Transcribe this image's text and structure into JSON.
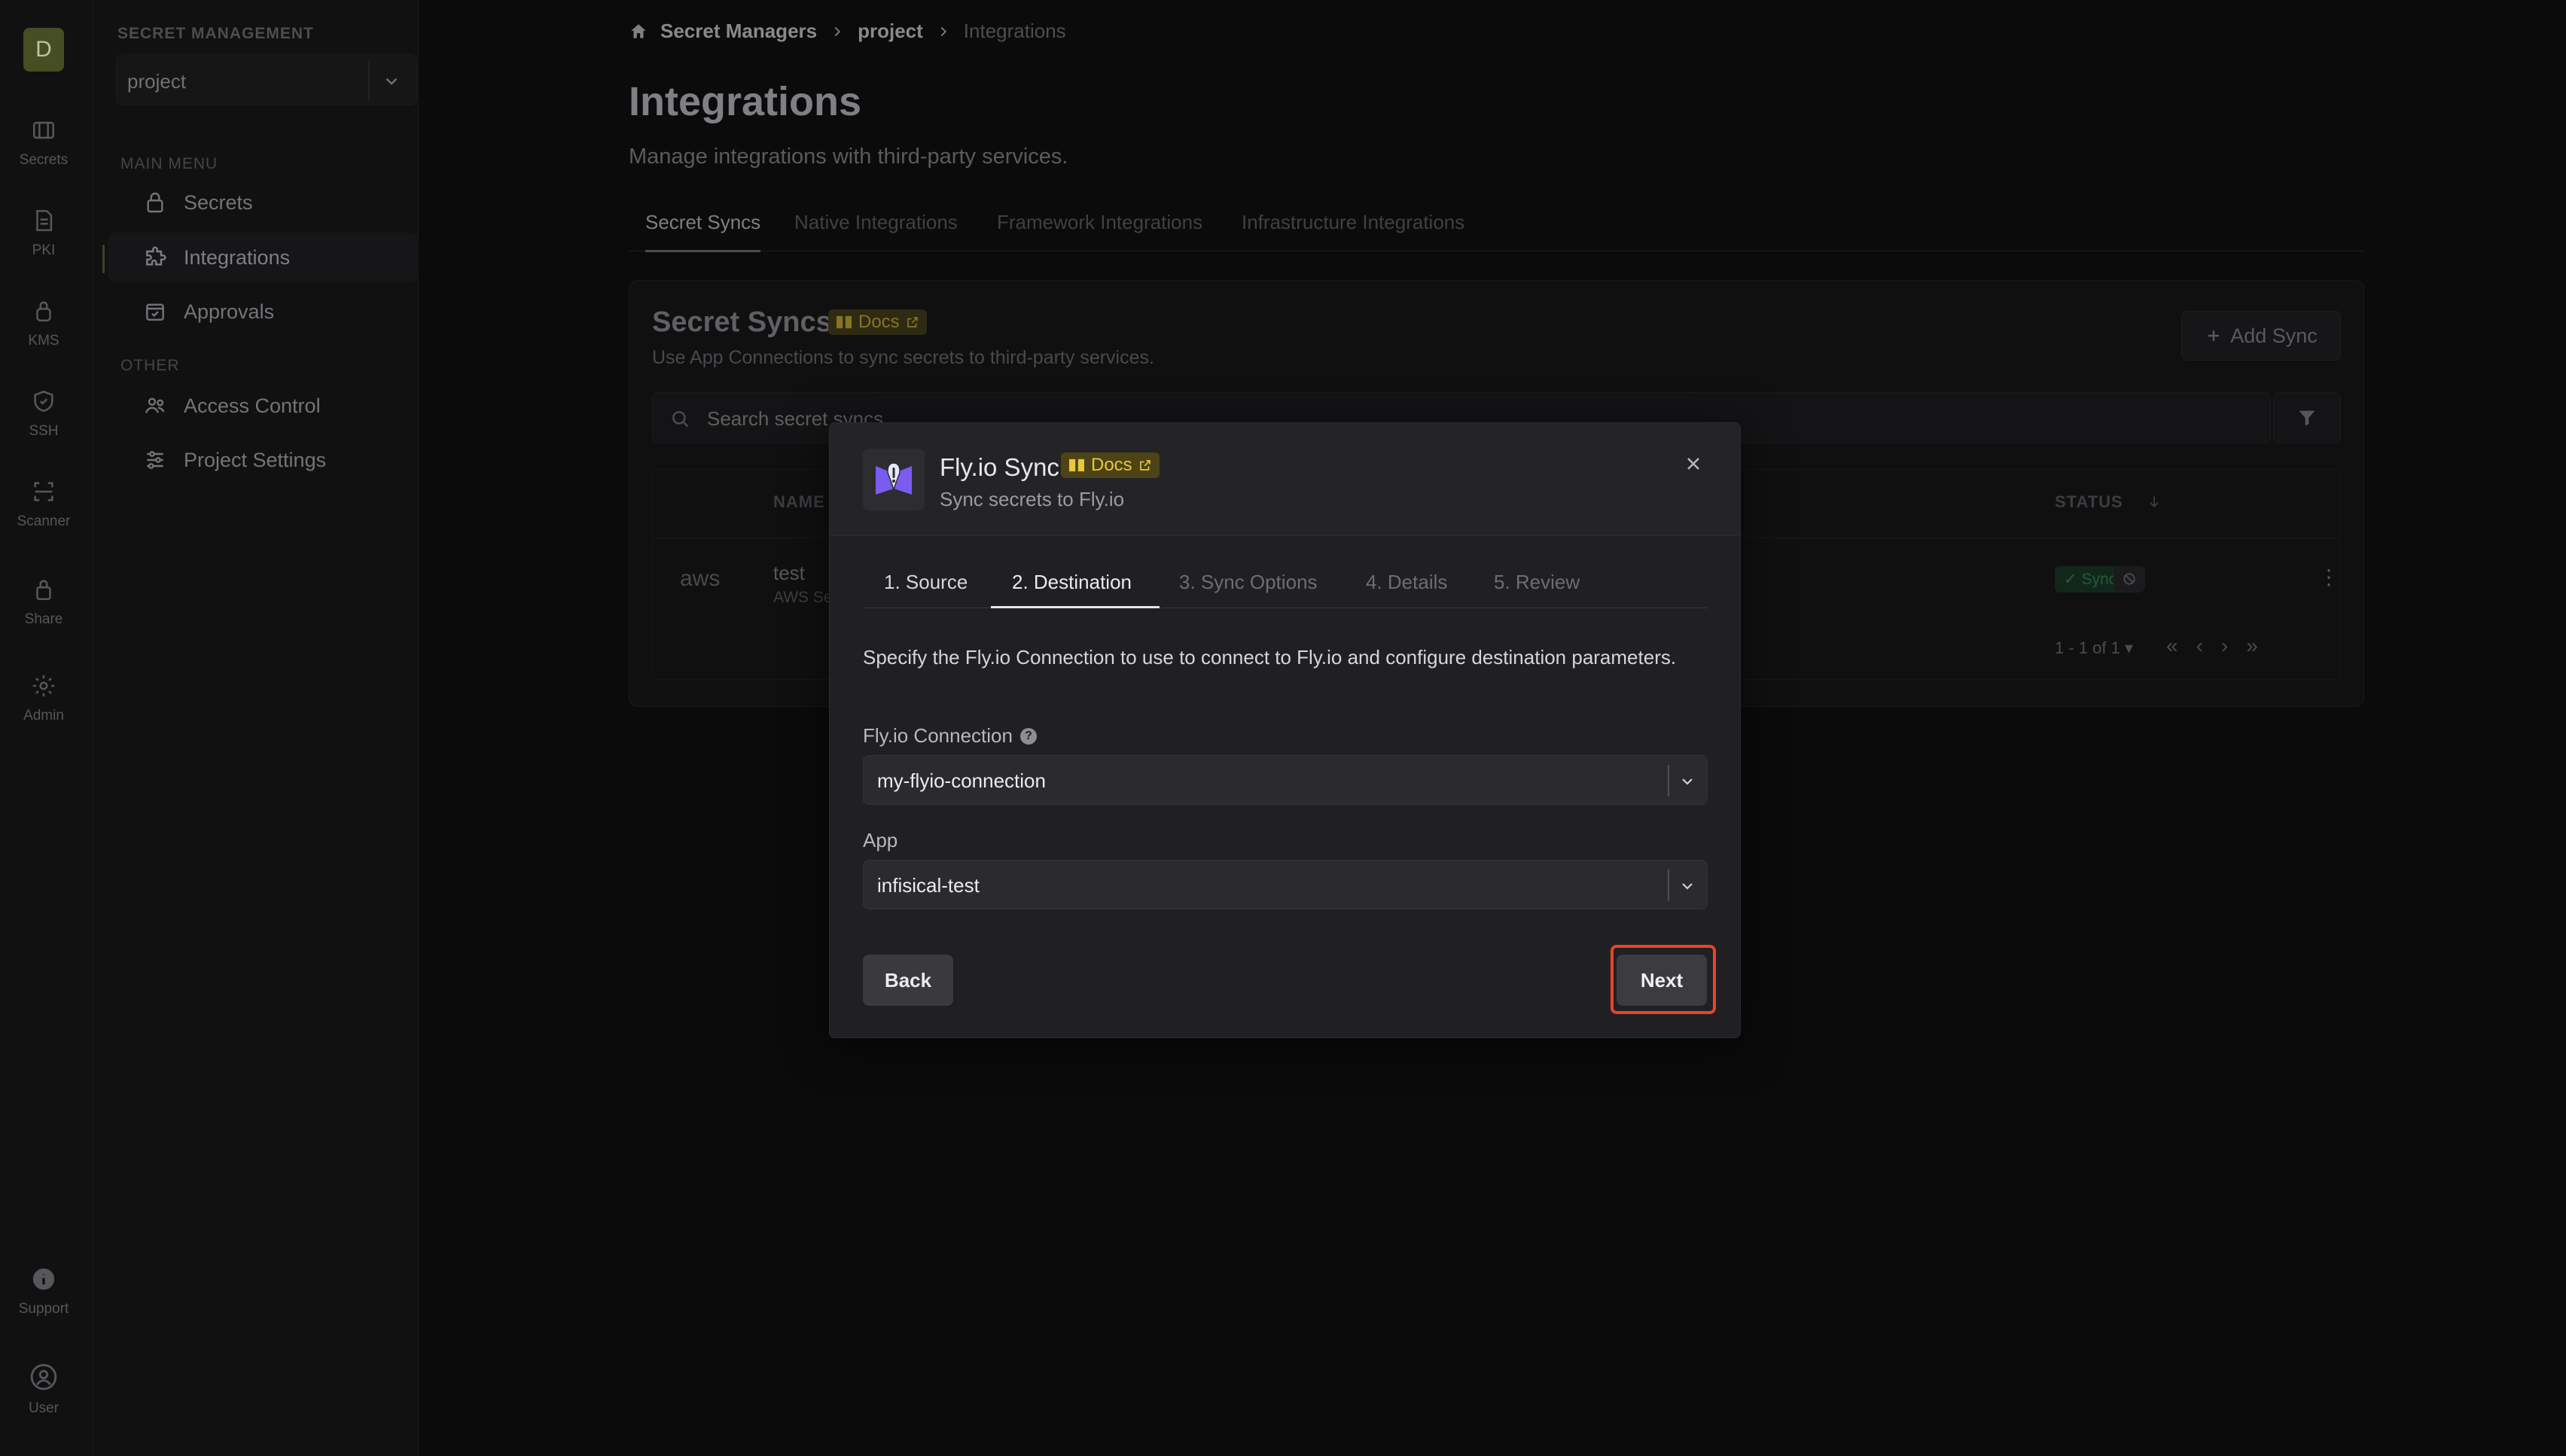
{
  "rail": {
    "avatar_letter": "D",
    "items": [
      {
        "label": "Secrets",
        "icon": "secrets-icon"
      },
      {
        "label": "PKI",
        "icon": "file-icon"
      },
      {
        "label": "KMS",
        "icon": "lock-icon"
      },
      {
        "label": "SSH",
        "icon": "shield-icon"
      },
      {
        "label": "Scanner",
        "icon": "scan-icon"
      },
      {
        "label": "Share",
        "icon": "lock-icon"
      },
      {
        "label": "Admin",
        "icon": "gear-icon"
      },
      {
        "label": "Support",
        "icon": "info-icon"
      },
      {
        "label": "User",
        "icon": "user-icon"
      }
    ]
  },
  "sidebar": {
    "heading": "SECRET MANAGEMENT",
    "project_select": "project",
    "main_menu_label": "MAIN MENU",
    "items": [
      {
        "label": "Secrets"
      },
      {
        "label": "Integrations"
      },
      {
        "label": "Approvals"
      }
    ],
    "other_label": "OTHER",
    "other_items": [
      {
        "label": "Access Control"
      },
      {
        "label": "Project Settings"
      }
    ]
  },
  "breadcrumb": {
    "root": "Secret Managers",
    "project": "project",
    "current": "Integrations"
  },
  "page": {
    "title": "Integrations",
    "subtitle": "Manage integrations with third-party services."
  },
  "tabs": [
    {
      "label": "Secret Syncs"
    },
    {
      "label": "Native Integrations"
    },
    {
      "label": "Framework Integrations"
    },
    {
      "label": "Infrastructure Integrations"
    }
  ],
  "card": {
    "title": "Secret Syncs",
    "docs": "Docs",
    "subtitle": "Use App Connections to sync secrets to third-party services.",
    "add_button": "Add Sync",
    "search_placeholder": "Search secret syncs...",
    "columns": {
      "name": "NAME",
      "status": "STATUS"
    },
    "row": {
      "provider": "aws",
      "name": "test",
      "type": "AWS Se",
      "status": "Synced"
    },
    "pagination": "1 - 1 of 1"
  },
  "modal": {
    "title": "Fly.io Sync",
    "docs": "Docs",
    "subtitle": "Sync secrets to Fly.io",
    "steps": [
      {
        "label": "1. Source"
      },
      {
        "label": "2. Destination"
      },
      {
        "label": "3. Sync Options"
      },
      {
        "label": "4. Details"
      },
      {
        "label": "5. Review"
      }
    ],
    "description": "Specify the Fly.io Connection to use to connect to Fly.io and configure destination parameters.",
    "connection_label": "Fly.io Connection",
    "connection_value": "my-flyio-connection",
    "app_label": "App",
    "app_value": "infisical-test",
    "back_button": "Back",
    "next_button": "Next"
  },
  "colors": {
    "highlight": "#e8432b",
    "docs_badge": "#e8c83a",
    "synced": "#2f6d43"
  }
}
